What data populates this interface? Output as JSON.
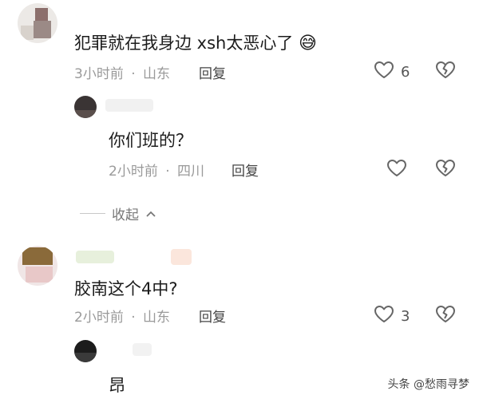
{
  "comments": [
    {
      "text": "犯罪就在我身边 xsh太恶心了",
      "emoji": "😅",
      "time": "3小时前",
      "location": "山东",
      "reply_label": "回复",
      "likes": "6",
      "replies": [
        {
          "text": "你们班的？",
          "time": "2小时前",
          "location": "四川",
          "reply_label": "回复",
          "likes": ""
        }
      ],
      "collapse_label": "收起"
    },
    {
      "text": "胶南这个4中?",
      "time": "2小时前",
      "location": "山东",
      "reply_label": "回复",
      "likes": "3",
      "replies": [
        {
          "text": "昂"
        }
      ]
    }
  ],
  "separator": "·",
  "watermark": "头条 @愁雨寻梦",
  "colors": {
    "text": "#1c1c1c",
    "meta": "#9a9a9a",
    "icon": "#666666"
  }
}
